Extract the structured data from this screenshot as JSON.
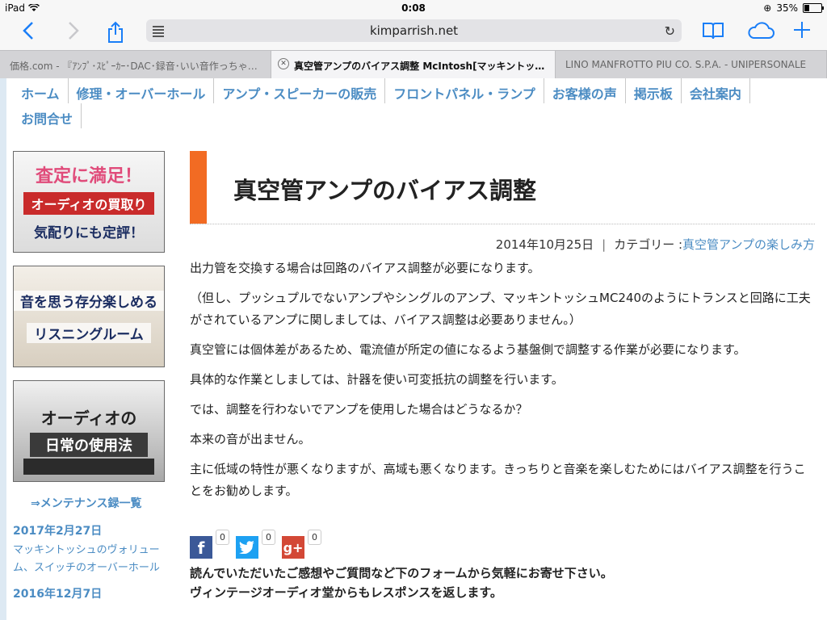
{
  "status": {
    "device": "iPad",
    "time": "0:08",
    "battery": "35%",
    "battery_level": 0.35
  },
  "browser": {
    "url": "kimparrish.net",
    "tabs": [
      {
        "title": "価格.com - 『ｱﾝﾌﾟ･ｽﾋﾟｰｶｰ･DAC･録音･いい音作っちゃ…"
      },
      {
        "title": "真空管アンプのバイアス調整 McIntosh[マッキントッ…"
      },
      {
        "title": "LINO MANFROTTO PIU CO. S.P.A. - UNIPERSONALE"
      }
    ]
  },
  "nav": {
    "row1": [
      "ホーム",
      "修理・オーバーホール",
      "アンプ・スピーカーの販売",
      "フロントパネル・ランプ",
      "お客様の声",
      "掲示板",
      "会社案内"
    ],
    "row2": [
      "お問合せ"
    ]
  },
  "sidebar": {
    "banner1": {
      "line1": "査定に満足！",
      "line2": "オーディオの買取り",
      "line3": "気配りにも定評！"
    },
    "banner2": {
      "line1": "音を思う存分楽しめる",
      "line2": "リスニングルーム"
    },
    "banner3": {
      "line1": "オーディオの",
      "line2": "日常の使用法"
    },
    "maintenance_link": "⇒メンテナンス録一覧",
    "news": [
      {
        "date": "2017年2月27日",
        "title": "マッキントッシュのヴォリューム、スイッチのオーバーホール"
      },
      {
        "date": "2016年12月7日",
        "title": ""
      }
    ]
  },
  "article": {
    "title": "真空管アンプのバイアス調整",
    "date": "2014年10月25日",
    "separator": "|",
    "category_label": "カテゴリー :",
    "category": "真空管アンプの楽しみ方",
    "paragraphs": [
      "出力管を交換する場合は回路のバイアス調整が必要になります。",
      "（但し、プッシュプルでないアンプやシングルのアンプ、マッキントッシュMC240のようにトランスと回路に工夫がされているアンプに関しましては、バイアス調整は必要ありません。）",
      "真空管には個体差があるため、電流値が所定の値になるよう基盤側で調整する作業が必要になります。",
      "具体的な作業としましては、計器を使い可変抵抗の調整を行います。",
      "では、調整を行わないでアンプを使用した場合はどうなるか？",
      "本来の音が出ません。",
      "主に低域の特性が悪くなりますが、高域も悪くなります。きっちりと音楽を楽しむためにはバイアス調整を行うことをお勧めします。"
    ],
    "social": [
      {
        "icon": "f",
        "count": "0"
      },
      {
        "icon": "t",
        "count": "0"
      },
      {
        "icon": "g+",
        "count": "0"
      }
    ],
    "closing_line1": "読んでいただいたご感想やご質問など下のフォームから気軽にお寄せ下さい。",
    "closing_line2": "ヴィンテージオーディオ堂からもレスポンスを返します。"
  }
}
